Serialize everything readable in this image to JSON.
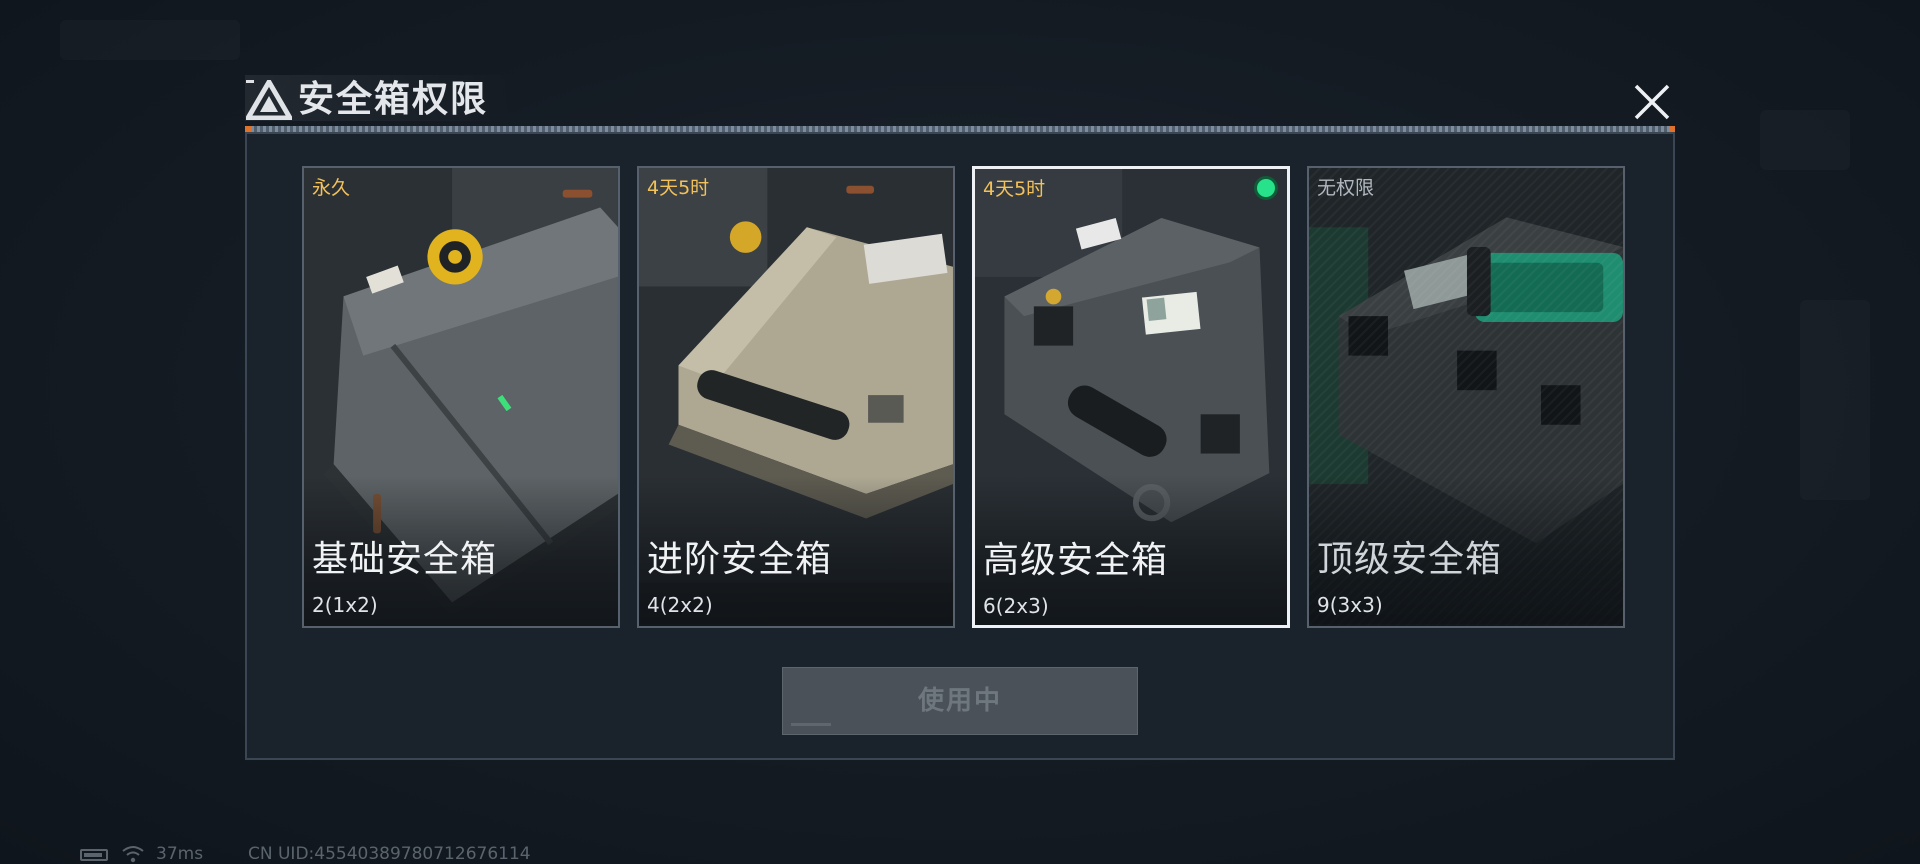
{
  "header": {
    "title": "安全箱权限",
    "logo_icon": "delta-logo-icon",
    "close_icon": "close-icon"
  },
  "cards": [
    {
      "tag": "永久",
      "tag_color": "#f2c15a",
      "name": "基础安全箱",
      "capacity": "2(1x2)",
      "selected": false,
      "locked": false,
      "theme": "grey-yellow"
    },
    {
      "tag": "4天5时",
      "tag_color": "#f2c15a",
      "name": "进阶安全箱",
      "capacity": "4(2x2)",
      "selected": false,
      "locked": false,
      "theme": "khaki"
    },
    {
      "tag": "4天5时",
      "tag_color": "#f2c15a",
      "name": "高级安全箱",
      "capacity": "6(2x3)",
      "selected": true,
      "locked": false,
      "status_dot_color": "#27e28a",
      "theme": "dark-grey"
    },
    {
      "tag": "无权限",
      "tag_color": "#b0b7bf",
      "name": "顶级安全箱",
      "capacity": "9(3x3)",
      "selected": false,
      "locked": true,
      "theme": "black-green"
    }
  ],
  "use_button": {
    "label": "使用中",
    "enabled": false
  },
  "status_bar": {
    "ping": "37ms",
    "uid": "CN UID:455403897807126761​14",
    "battery_icon": "battery-icon",
    "wifi_icon": "wifi-icon"
  },
  "colors": {
    "accent_orange": "#e0732b",
    "selected_border": "#eef2f6",
    "active_dot": "#27e28a",
    "timer_gold": "#f2c15a"
  }
}
